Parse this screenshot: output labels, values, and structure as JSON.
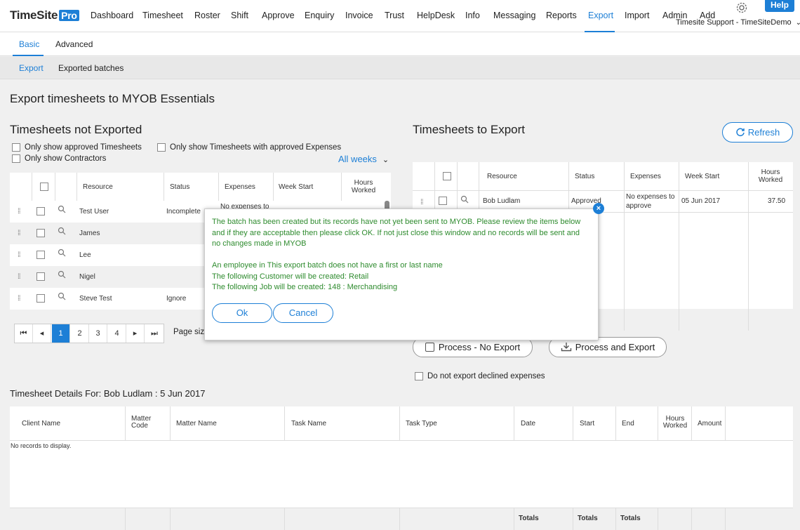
{
  "brand": {
    "name": "TimeSite",
    "badge": "Pro"
  },
  "nav": {
    "items": [
      "Dashboard",
      "Timesheet",
      "Roster",
      "Shift",
      "Approve",
      "Enquiry",
      "Invoice",
      "Trust",
      "HelpDesk",
      "Info",
      "Messaging",
      "Reports",
      "Export",
      "Import",
      "Admin",
      "Add"
    ],
    "active": "Export",
    "help": "Help",
    "user": "Timesite Support - TimeSiteDemo"
  },
  "tabs": {
    "basic": "Basic",
    "advanced": "Advanced",
    "export": "Export",
    "exported_batches": "Exported batches"
  },
  "page_title": "Export timesheets to MYOB Essentials",
  "left": {
    "title": "Timesheets not Exported",
    "filters": {
      "approved": "Only show approved Timesheets",
      "approved_expenses": "Only show Timesheets with approved Expenses",
      "contractors": "Only show Contractors"
    },
    "weeks": "All weeks",
    "columns": {
      "resource": "Resource",
      "status": "Status",
      "expenses": "Expenses",
      "week_start": "Week Start",
      "hours_worked": "Hours Worked"
    },
    "rows": [
      {
        "resource": "Test User",
        "status": "Incomplete",
        "expenses": "No expenses to"
      },
      {
        "resource": "James",
        "status": "",
        "expenses": ""
      },
      {
        "resource": "Lee",
        "status": "",
        "expenses": ""
      },
      {
        "resource": "Nigel",
        "status": "",
        "expenses": ""
      },
      {
        "resource": "Steve Test",
        "status": "Ignore",
        "expenses": ""
      }
    ],
    "pager": {
      "pages": [
        "1",
        "2",
        "3",
        "4"
      ],
      "page_size_label": "Page size"
    }
  },
  "right": {
    "title": "Timesheets to Export",
    "refresh": "Refresh",
    "columns": {
      "resource": "Resource",
      "status": "Status",
      "expenses": "Expenses",
      "week_start": "Week Start",
      "hours_worked": "Hours Worked"
    },
    "rows": [
      {
        "resource": "Bob Ludlam",
        "status": "Approved",
        "expenses": "No expenses to approve",
        "week_start": "05 Jun 2017",
        "hours": "37.50"
      }
    ],
    "process_no_export": "Process - No Export",
    "process_and_export": "Process and Export",
    "no_declined": "Do not export declined expenses"
  },
  "details": {
    "title": "Timesheet Details For: Bob Ludlam : 5 Jun 2017",
    "columns": [
      "Client Name",
      "Matter Code",
      "Matter Name",
      "Task Name",
      "Task Type",
      "Date",
      "Start",
      "End",
      "Hours Worked",
      "Amount"
    ],
    "empty": "No records to display.",
    "totals": "Totals"
  },
  "dialog": {
    "line1": "The batch has been created but its records have not yet been sent to MYOB. Please review the items below",
    "line2": "and if they are acceptable then please click OK. If not just close this window and no records will be sent and",
    "line3": "no changes made in MYOB",
    "line4": "An employee in This export batch does not have a first or last name",
    "line5": "The following Customer will be created: Retail",
    "line6": "The following Job will be created: 148 : Merchandising",
    "ok": "Ok",
    "cancel": "Cancel"
  }
}
